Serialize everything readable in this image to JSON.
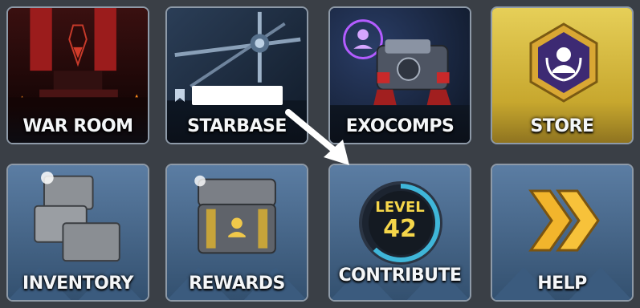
{
  "tiles": [
    {
      "id": "war-room",
      "label": "WAR ROOM"
    },
    {
      "id": "starbase",
      "label": "STARBASE"
    },
    {
      "id": "exocomps",
      "label": "EXOCOMPS"
    },
    {
      "id": "store",
      "label": "STORE"
    },
    {
      "id": "inventory",
      "label": "INVENTORY"
    },
    {
      "id": "rewards",
      "label": "REWARDS"
    },
    {
      "id": "contribute",
      "label": "CONTRIBUTE",
      "level_label": "LEVEL",
      "level_value": "42"
    },
    {
      "id": "help",
      "label": "HELP"
    }
  ],
  "colors": {
    "tile_border": "#8e9aa8",
    "store_gold": "#d4b53a",
    "level_yellow": "#f5d64a",
    "level_ring": "#3fb6d9",
    "war_room_red": "#9b1c1c"
  },
  "icons": {
    "starbase_bookmark": "bookmark-icon",
    "help_chevrons": "double-chevron-right-icon",
    "store_badge": "crew-laurel-badge-icon",
    "pointer": "arrow-pointer-icon"
  }
}
